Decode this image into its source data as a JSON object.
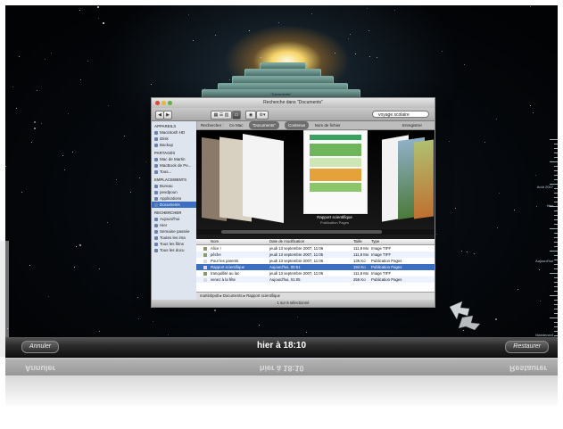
{
  "window": {
    "title": "Recherche dans \"Documents\"",
    "stack_title": "\"Documents\"",
    "search_value": "voyage scolaire"
  },
  "searchbar": {
    "label": "Rechercher :",
    "scope_mac": "Ce Mac",
    "scope_documents": "\"Documents\"",
    "scope_contents": "Contenus",
    "scope_filename": "Nom de fichier",
    "save": "Enregistrer"
  },
  "sidebar": {
    "sections": [
      {
        "title": "APPAREILS",
        "items": [
          "Macintosh HD",
          "iDisk",
          "Backup"
        ]
      },
      {
        "title": "PARTAGÉS",
        "items": [
          "Mac de Martin",
          "MacBook de Pe...",
          "Tous..."
        ]
      },
      {
        "title": "EMPLACEMENTS",
        "items": [
          "Bureau",
          "pevdpoun",
          "Applications",
          "Documents"
        ]
      },
      {
        "title": "RECHERCHER",
        "items": [
          "Aujourd'hui",
          "Hier",
          "Semaine passée",
          "Toutes les ima",
          "Tous les films",
          "Tous les docu"
        ]
      }
    ],
    "selected": "Documents"
  },
  "coverflow": {
    "caption_title": "Rapport scientifique",
    "caption_sub": "Publication Pages"
  },
  "file_list": {
    "columns": [
      "Nom",
      "Date de modification",
      "Taille",
      "Type"
    ],
    "rows": [
      {
        "name": "Alice !",
        "date": "jeudi 13 septembre 2007, 11:06",
        "size": "111,8 Mo",
        "type": "Image TIFF"
      },
      {
        "name": "pêche",
        "date": "jeudi 13 septembre 2007, 11:05",
        "size": "111,8 Mo",
        "type": "Image TIFF"
      },
      {
        "name": "Pour les parents",
        "date": "jeudi 13 septembre 2007, 11:06",
        "size": "136 Ko",
        "type": "Publication Pages"
      },
      {
        "name": "Rapport scientifique",
        "date": "Aujourd'hui, 00:51",
        "size": "184 Ko",
        "type": "Publication Pages"
      },
      {
        "name": "tranquillité au lac",
        "date": "jeudi 13 septembre 2007, 11:06",
        "size": "111,8 Mo",
        "type": "Image TIFF"
      },
      {
        "name": "venez à la fête",
        "date": "Aujourd'hui, 01:05",
        "size": "256 Ko",
        "type": "Publication Pages"
      }
    ],
    "selected_index": 3
  },
  "pathbar": [
    "martinbpolt",
    "Documents",
    "Rapport scientifique"
  ],
  "status": "1 sur 6 sélectionné",
  "timeline": {
    "labels": [
      "Août 2007",
      "Hier",
      "Aujourd'hui",
      "Maintenant"
    ]
  },
  "bottom": {
    "cancel": "Annuler",
    "time": "hier à 18:10",
    "restore": "Restaurer"
  },
  "colors": {
    "selection": "#3d6fc0",
    "sidebar_bg": "#dfe5ee",
    "space": "#05080c"
  }
}
